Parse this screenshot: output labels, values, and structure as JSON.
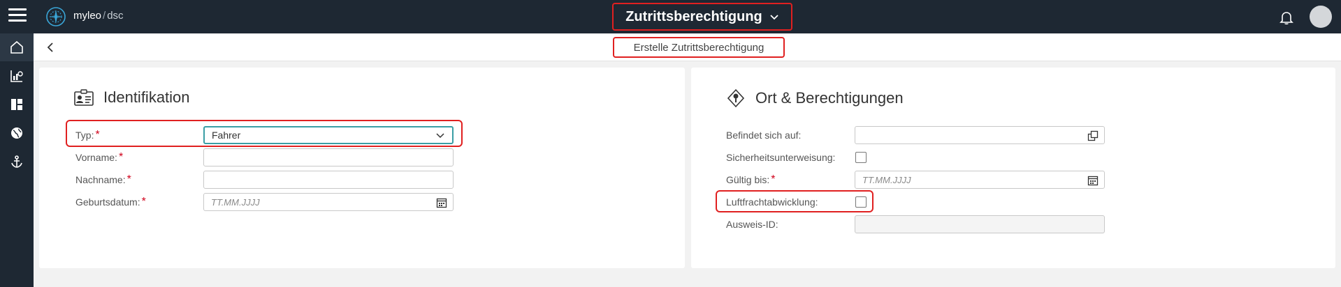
{
  "header": {
    "brand_name": "myleo",
    "brand_separator": "/",
    "brand_sub": "dsc",
    "title": "Zutrittsberechtigung",
    "title_chevron": "chevron-down-icon"
  },
  "subheader": {
    "title": "Erstelle Zutrittsberechtigung"
  },
  "sidenav": {
    "items": [
      {
        "icon": "home-icon"
      },
      {
        "icon": "analytics-icon"
      },
      {
        "icon": "dashboard-icon"
      },
      {
        "icon": "globe-icon"
      },
      {
        "icon": "anchor-icon"
      }
    ]
  },
  "left_panel": {
    "title": "Identifikation",
    "fields": {
      "typ": {
        "label": "Typ:",
        "required": "*",
        "value": "Fahrer"
      },
      "vorname": {
        "label": "Vorname:",
        "required": "*",
        "value": ""
      },
      "nachname": {
        "label": "Nachname:",
        "required": "*",
        "value": ""
      },
      "geburtsdatum": {
        "label": "Geburtsdatum:",
        "required": "*",
        "placeholder": "TT.MM.JJJJ"
      }
    }
  },
  "right_panel": {
    "title": "Ort & Berechtigungen",
    "fields": {
      "befindet": {
        "label": "Befindet sich auf:",
        "value": ""
      },
      "sicherheit": {
        "label": "Sicherheitsunterweisung:",
        "checked": false
      },
      "gueltig": {
        "label": "Gültig bis:",
        "required": "*",
        "placeholder": "TT.MM.JJJJ"
      },
      "luftfracht": {
        "label": "Luftfrachtabwicklung:",
        "checked": false
      },
      "ausweis": {
        "label": "Ausweis-ID:",
        "value": ""
      }
    }
  },
  "colors": {
    "topbar": "#1e2833",
    "accent_teal": "#3a9ea5",
    "required_red": "#d0021b",
    "highlight_red": "#e02020"
  }
}
